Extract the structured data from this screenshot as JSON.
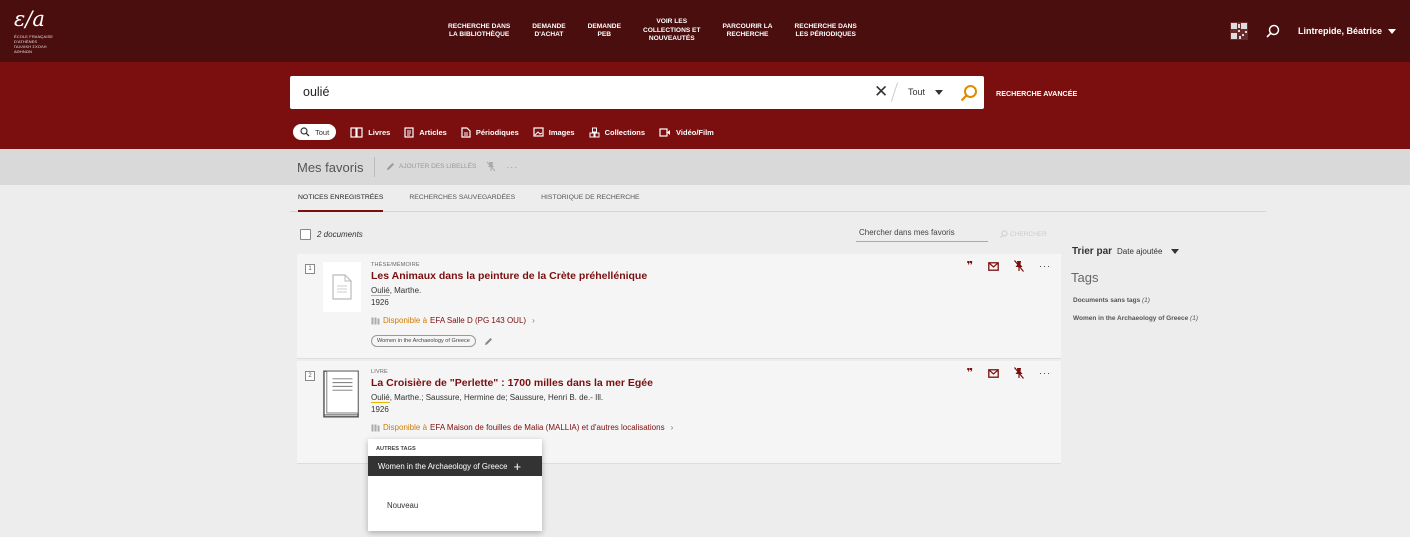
{
  "logo": {
    "mark": "ε/a",
    "sub1": "ÉCOLE FRANÇAISE D'ATHÈNES",
    "sub2": "ΓΑΛΛΙΚΗ ΣΧΟΛΗ ΑΘΗΝΩΝ"
  },
  "nav": [
    "RECHERCHE DANS\nLA BIBLIOTHÈQUE",
    "DEMANDE\nD'ACHAT",
    "DEMANDE\nPEB",
    "VOIR LES\nCOLLECTIONS ET\nNOUVEAUTÉS",
    "PARCOURIR LA\nRECHERCHE",
    "RECHERCHE DANS\nLES PÉRIODIQUES"
  ],
  "user": {
    "name": "Lintrepide, Béatrice"
  },
  "search": {
    "value": "oulié",
    "clear": "✕",
    "scope": "Tout",
    "advanced": "RECHERCHE AVANCÉE"
  },
  "types": [
    {
      "label": "Tout",
      "icon": "search-icon"
    },
    {
      "label": "Livres",
      "icon": "books-icon"
    },
    {
      "label": "Articles",
      "icon": "article-icon"
    },
    {
      "label": "Périodiques",
      "icon": "periodical-icon"
    },
    {
      "label": "Images",
      "icon": "image-icon"
    },
    {
      "label": "Collections",
      "icon": "collections-icon"
    },
    {
      "label": "Vidéo/Film",
      "icon": "video-icon"
    }
  ],
  "favorites": {
    "title": "Mes favoris",
    "add_labels": "AJOUTER DES LIBELLÉS",
    "more": "···"
  },
  "tabs": [
    "NOTICES ENREGISTRÉES",
    "RECHERCHES SAUVEGARDÉES",
    "HISTORIQUE DE RECHERCHE"
  ],
  "list": {
    "count": "2 documents",
    "search_placeholder": "Chercher dans mes favoris",
    "search_button": "CHERCHER"
  },
  "records": [
    {
      "num": "1",
      "type": "THÈSE/MÉMOIRE",
      "title": "Les Animaux dans la peinture de la Crète préhellénique",
      "author_hl": "Oulié",
      "author_rest": ", Marthe.",
      "year": "1926",
      "dispo": "Disponible à",
      "location": "EFA  Salle D (PG 143 OUL)",
      "arrow": "›",
      "tag": "Women in the Archaeology of Greece"
    },
    {
      "num": "2",
      "type": "LIVRE",
      "title": "La Croisière de \"Perlette\" : 1700 milles dans la mer Egée",
      "author_hl": "Oulié",
      "author_rest": ", Marthe.; Saussure, Hermine de; Saussure, Henri B. de.- Ill.",
      "year": "1926",
      "dispo": "Disponible à",
      "location": "EFA  Maison de fouilles de Malia (MALLIA) et d'autres localisations",
      "arrow": "›"
    }
  ],
  "record_icons": {
    "quote": "❞",
    "dots": "···"
  },
  "sidebar": {
    "sort_label": "Trier par",
    "sort_value": "Date ajoutée",
    "tags_title": "Tags",
    "tag_links": [
      {
        "label": "Documents sans tags",
        "count": "(1)"
      },
      {
        "label": "Women in the Archaeology of Greece",
        "count": "(1)"
      }
    ]
  },
  "popup": {
    "header": "AUTRES TAGS",
    "item": "Women in the Archaeology of Greece",
    "plus": "+",
    "new": "Nouveau"
  },
  "colors": {
    "top_nav": "#4a0e0e",
    "search_band": "#7b0e0e",
    "accent": "#7b0e0e",
    "available": "#d07a00"
  }
}
